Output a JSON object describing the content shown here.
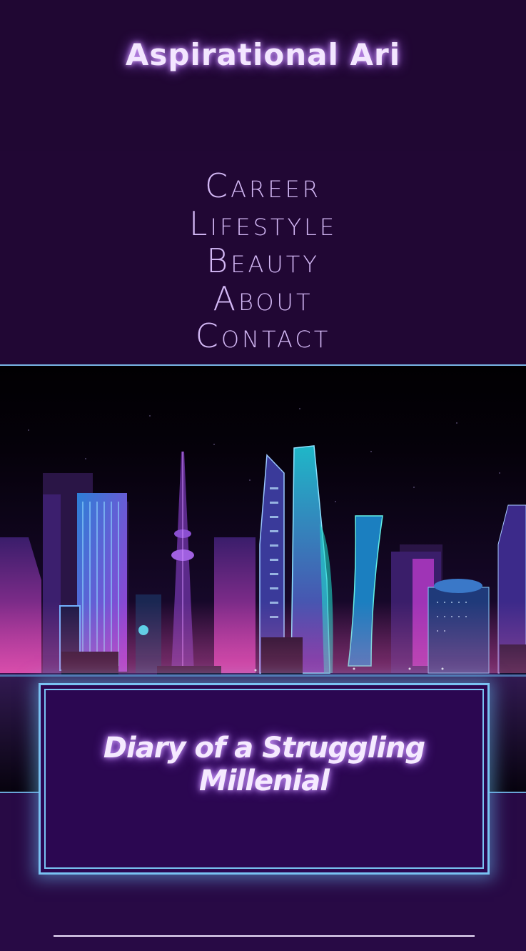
{
  "site": {
    "title": "Aspirational Ari"
  },
  "nav": {
    "items": [
      {
        "label": "Career"
      },
      {
        "label": "Lifestyle"
      },
      {
        "label": "Beauty"
      },
      {
        "label": "About"
      },
      {
        "label": "Contact"
      }
    ]
  },
  "hero": {
    "image_name": "neon-city-skyline-illustration"
  },
  "banner": {
    "title": "Diary of a Struggling Millenial"
  },
  "colors": {
    "header_bg": "#200733",
    "nav_text": "#d3b8f5",
    "accent_line": "#79b4e4",
    "banner_bg": "#2b0751",
    "banner_border": "#79c2f2",
    "page_bg": "#280a45"
  }
}
